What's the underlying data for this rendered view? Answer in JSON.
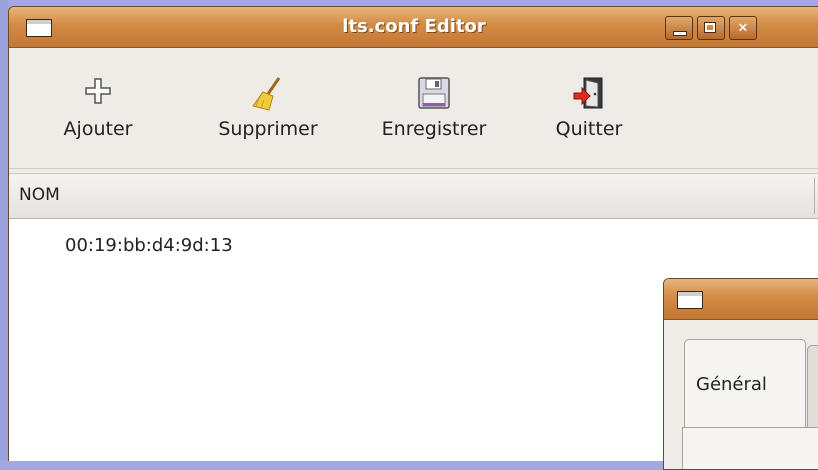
{
  "window": {
    "title": "lts.conf Editor",
    "controls": {
      "minimize": "minimize",
      "maximize": "maximize",
      "close": "×"
    }
  },
  "toolbar": {
    "add_label": "Ajouter",
    "delete_label": "Supprimer",
    "save_label": "Enregistrer",
    "quit_label": "Quitter"
  },
  "list": {
    "columns": [
      "NOM"
    ],
    "rows": [
      "00:19:bb:d4:9d:13"
    ]
  },
  "dialog": {
    "tabs": [
      "Général"
    ]
  },
  "colors": {
    "titlebar": "#d28b45",
    "desktop": "#a3a9de",
    "window_bg": "#efebe7"
  }
}
